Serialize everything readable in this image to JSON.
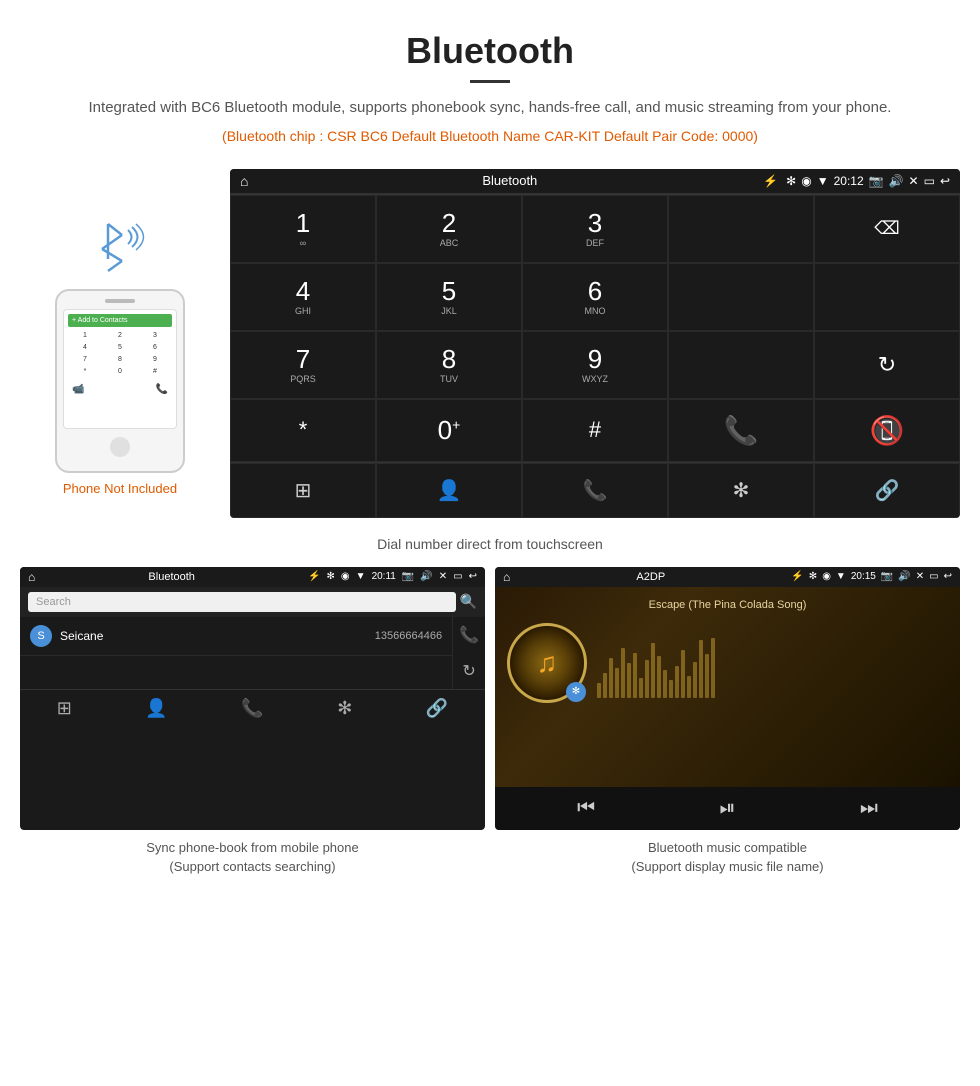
{
  "page": {
    "title": "Bluetooth",
    "subtitle": "Integrated with BC6 Bluetooth module, supports phonebook sync, hands-free call, and music streaming from your phone.",
    "specs": "(Bluetooth chip : CSR BC6    Default Bluetooth Name CAR-KIT    Default Pair Code: 0000)",
    "main_caption": "Dial number direct from touchscreen",
    "phone_not_included": "Phone Not Included"
  },
  "car_screen": {
    "status_bar": {
      "title": "Bluetooth",
      "time": "20:12"
    },
    "keypad": [
      {
        "num": "1",
        "alpha": "∞",
        "col": 1
      },
      {
        "num": "2",
        "alpha": "ABC",
        "col": 2
      },
      {
        "num": "3",
        "alpha": "DEF",
        "col": 3
      },
      {
        "num": "4",
        "alpha": "GHI",
        "col": 1
      },
      {
        "num": "5",
        "alpha": "JKL",
        "col": 2
      },
      {
        "num": "6",
        "alpha": "MNO",
        "col": 3
      },
      {
        "num": "7",
        "alpha": "PQRS",
        "col": 1
      },
      {
        "num": "8",
        "alpha": "TUV",
        "col": 2
      },
      {
        "num": "9",
        "alpha": "WXYZ",
        "col": 3
      },
      {
        "num": "*",
        "alpha": "",
        "col": 1
      },
      {
        "num": "0",
        "alpha": "+",
        "col": 2
      },
      {
        "num": "#",
        "alpha": "",
        "col": 3
      }
    ]
  },
  "phonebook_screen": {
    "status_title": "Bluetooth",
    "status_time": "20:11",
    "search_placeholder": "Search",
    "contact": {
      "initial": "S",
      "name": "Seicane",
      "number": "13566664466"
    },
    "bottom_caption": "Sync phone-book from mobile phone\n(Support contacts searching)"
  },
  "music_screen": {
    "status_title": "A2DP",
    "status_time": "20:15",
    "song_title": "Escape (The Pina Colada Song)",
    "bottom_caption": "Bluetooth music compatible\n(Support display music file name)"
  },
  "phone_keys": [
    "1",
    "2",
    "3",
    "4",
    "5",
    "6",
    "7",
    "8",
    "9",
    "*",
    "0",
    "#"
  ]
}
